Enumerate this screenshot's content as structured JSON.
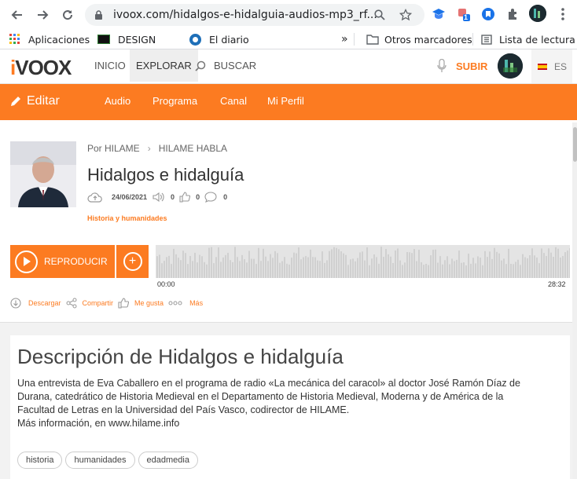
{
  "browser": {
    "url": "ivoox.com/hidalgos-e-hidalguia-audios-mp3_rf...",
    "ext_badge": "1",
    "bookmarks": {
      "apps": "Aplicaciones",
      "design": "DESIGN",
      "diario": "El diario",
      "overflow": "»",
      "others": "Otros marcadores",
      "reading": "Lista de lectura"
    }
  },
  "header": {
    "logo_i": "i",
    "logo_rest": "VOOX",
    "nav": {
      "inicio": "INICIO",
      "explorar": "EXPLORAR",
      "buscar": "BUSCAR"
    },
    "upload": "SUBIR",
    "lang": "ES"
  },
  "orange_bar": {
    "edit": "Editar",
    "tabs": [
      "Audio",
      "Programa",
      "Canal",
      "Mi Perfil"
    ]
  },
  "episode": {
    "by": "Por HILAME",
    "program": "HILAME HABLA",
    "title": "Hidalgos e hidalguía",
    "date": "24/06/2021",
    "listens": "0",
    "likes": "0",
    "comments": "0",
    "category": "Historia y humanidades",
    "play_label": "REPRODUCIR",
    "time_start": "00:00",
    "time_end": "28:32",
    "progress": 0
  },
  "actions": {
    "download": "Descargar",
    "share": "Compartir",
    "like": "Me gusta",
    "more": "Más"
  },
  "description": {
    "heading": "Descripción de Hidalgos e hidalguía",
    "lines": [
      "Una entrevista de Eva Caballero en el programa de radio «La mecánica del caracol» al doctor José Ramón Díaz de",
      "Durana, catedrático de Historia Medieval en el Departamento de Historia Medieval, Moderna y de América de la",
      "Facultad de Letras en la Universidad del País Vasco, codirector de HILAME.",
      "Más información, en www.hilame.info"
    ],
    "tags": [
      "historia",
      "humanidades",
      "edadmedia"
    ]
  },
  "colors": {
    "accent": "#fc7b21"
  }
}
